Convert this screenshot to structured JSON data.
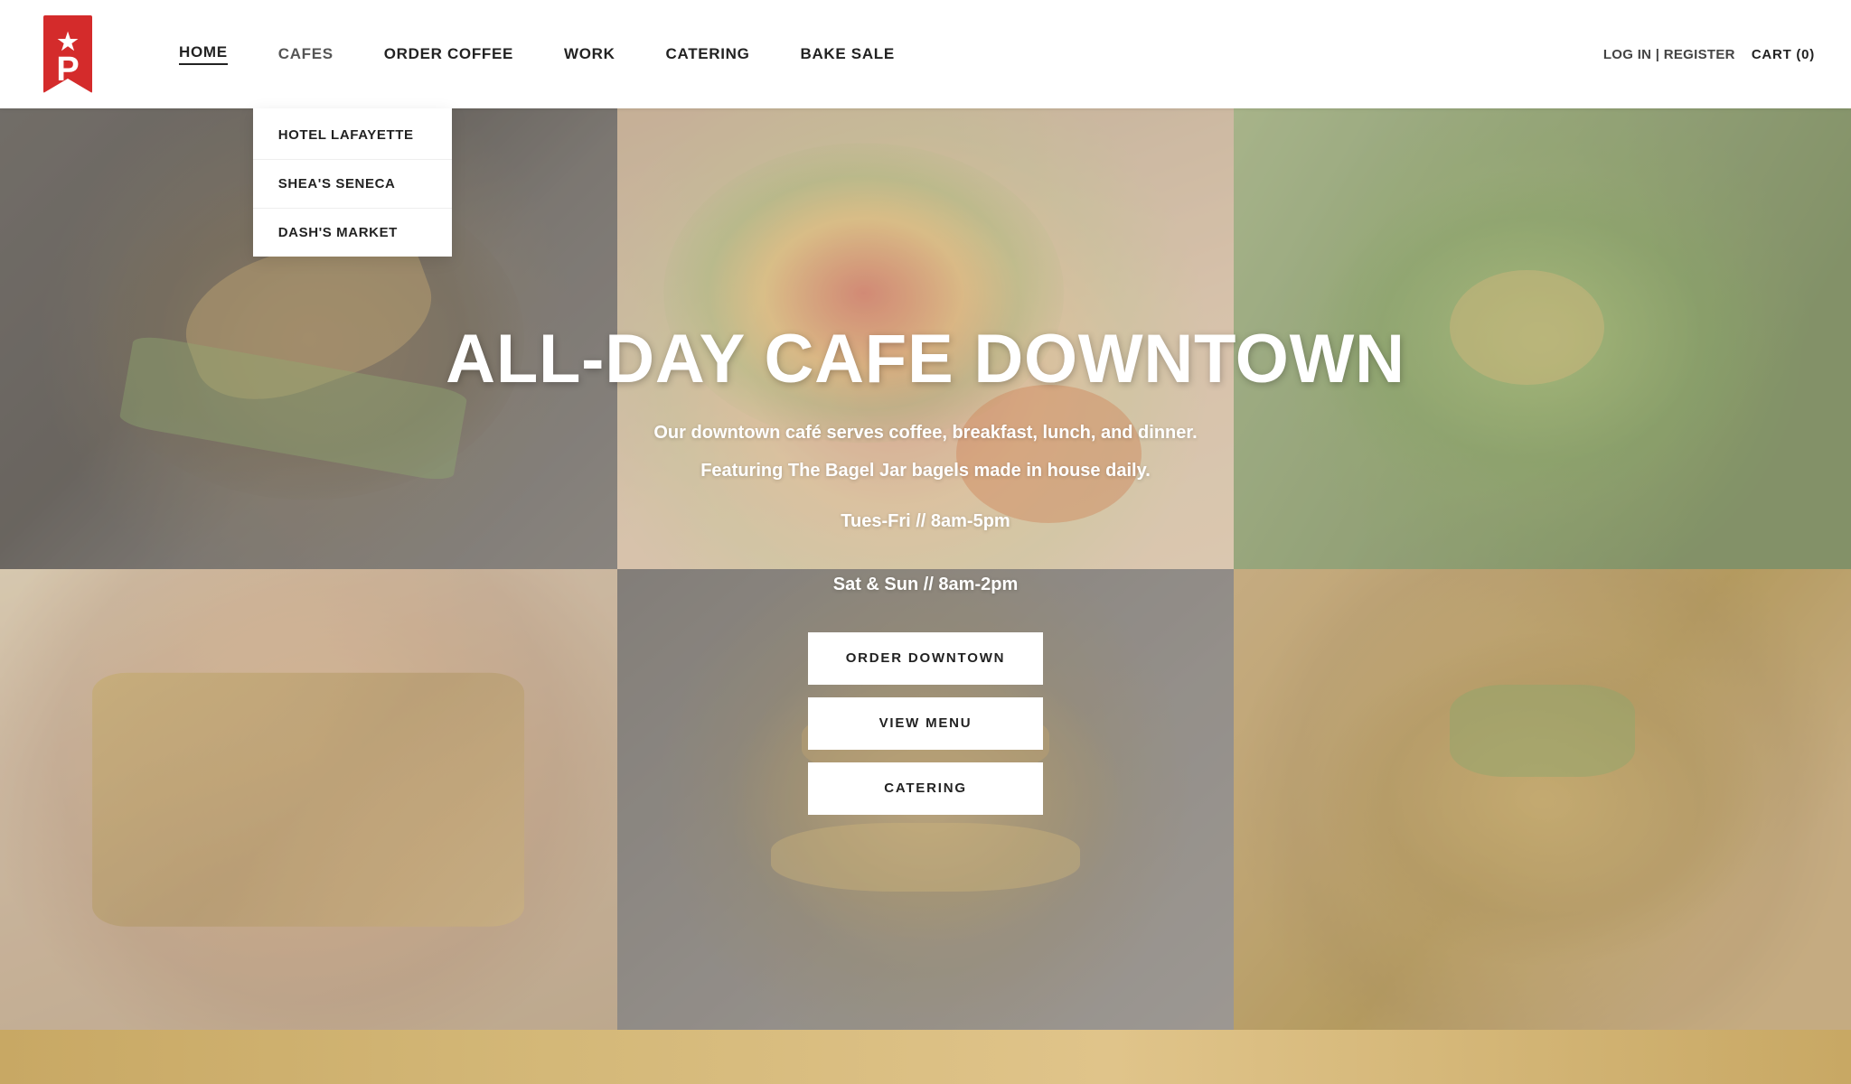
{
  "logo": {
    "letter": "P",
    "star": "★"
  },
  "nav": {
    "items": [
      {
        "id": "home",
        "label": "HOME",
        "active": true,
        "has_dropdown": false
      },
      {
        "id": "cafes",
        "label": "CAFES",
        "active": false,
        "has_dropdown": true
      },
      {
        "id": "order-coffee",
        "label": "ORDER COFFEE",
        "active": false,
        "has_dropdown": false
      },
      {
        "id": "work",
        "label": "WORK",
        "active": false,
        "has_dropdown": false
      },
      {
        "id": "catering",
        "label": "CATERING",
        "active": false,
        "has_dropdown": false
      },
      {
        "id": "bake-sale",
        "label": "BAKE SALE",
        "active": false,
        "has_dropdown": false
      }
    ],
    "dropdown_cafes": [
      {
        "id": "hotel-lafayette",
        "label": "HOTEL LAFAYETTE"
      },
      {
        "id": "sheas-seneca",
        "label": "SHEA'S SENECA"
      },
      {
        "id": "dashs-market",
        "label": "DASH'S MARKET"
      }
    ]
  },
  "header_right": {
    "auth": "LOG IN | REGISTER",
    "cart": "CART (0)"
  },
  "hero": {
    "title": "ALL-DAY CAFE DOWNTOWN",
    "subtitle1": "Our downtown café serves coffee, breakfast, lunch, and dinner.",
    "subtitle2": "Featuring The Bagel Jar bagels made in house daily.",
    "hours1": "Tues-Fri // 8am-5pm",
    "hours2": "Sat & Sun // 8am-2pm",
    "btn_order": "ORDER DOWNTOWN",
    "btn_menu": "VIEW MENU",
    "btn_catering": "CATERING"
  }
}
